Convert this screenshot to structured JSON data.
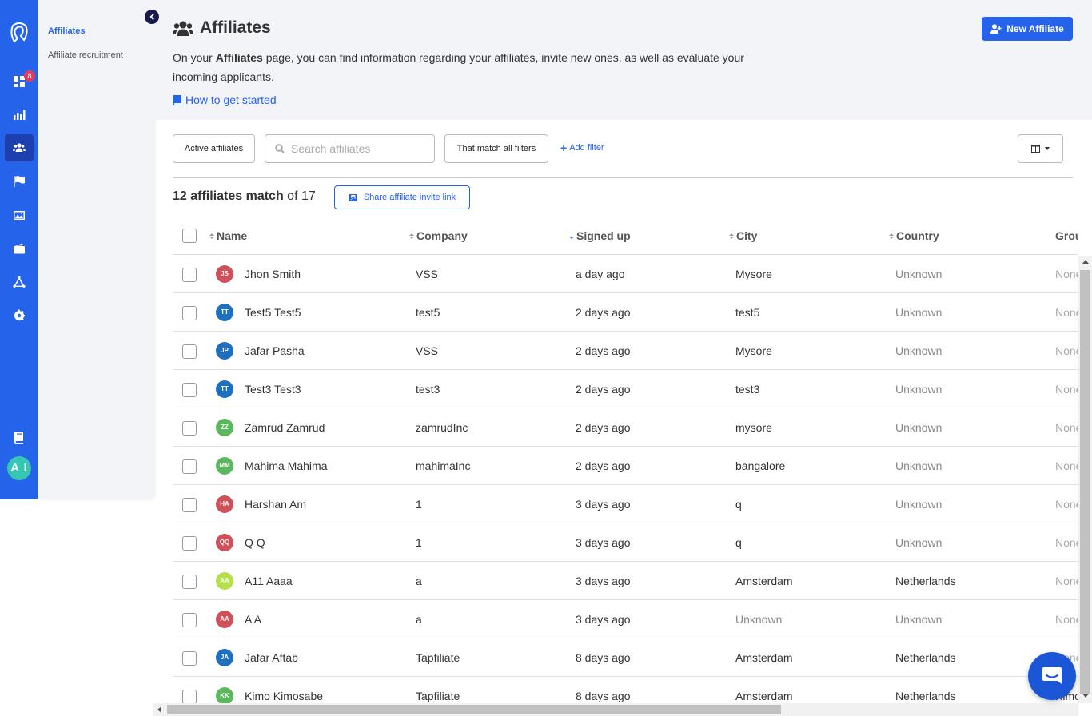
{
  "rail": {
    "badge_count": "8",
    "avatar_initials": "A I",
    "items": [
      {
        "icon": "dashboard-icon"
      },
      {
        "icon": "reports-icon"
      },
      {
        "icon": "affiliates-icon",
        "active": true
      },
      {
        "icon": "programs-flag-icon"
      },
      {
        "icon": "assets-image-icon"
      },
      {
        "icon": "payouts-wallet-icon"
      },
      {
        "icon": "integrations-icon"
      },
      {
        "icon": "settings-gear-icon"
      },
      {
        "icon": "docs-book-icon"
      }
    ]
  },
  "submenu": {
    "items": [
      "Affiliates",
      "Affiliate recruitment"
    ]
  },
  "header": {
    "title": "Affiliates",
    "intro_prefix": "On your ",
    "intro_bold": "Affiliates",
    "intro_suffix": " page, you can find information regarding your affiliates, invite new ones, as well as evaluate your incoming applicants.",
    "help_link": "How to get started",
    "new_button": "New Affiliate"
  },
  "filters": {
    "status": "Active affiliates",
    "search_placeholder": "Search affiliates",
    "match_mode": "That match all filters",
    "add_filter": "Add filter"
  },
  "summary": {
    "match_count": "12 affiliates match",
    "total": " of 17",
    "share_button": "Share affiliate invite link"
  },
  "table": {
    "columns": [
      "Name",
      "Company",
      "Signed up",
      "City",
      "Country",
      "Group"
    ],
    "rows": [
      {
        "initials": "JS",
        "color": "#d0505a",
        "name": "Jhon Smith",
        "company": "VSS",
        "signed_up": "a day ago",
        "city": "Mysore",
        "country": "Unknown",
        "group": "None"
      },
      {
        "initials": "TT",
        "color": "#1e6fc0",
        "name": "Test5 Test5",
        "company": "test5",
        "signed_up": "2 days ago",
        "city": "test5",
        "country": "Unknown",
        "group": "None"
      },
      {
        "initials": "JP",
        "color": "#1e6fc0",
        "name": "Jafar Pasha",
        "company": "VSS",
        "signed_up": "2 days ago",
        "city": "Mysore",
        "country": "Unknown",
        "group": "None"
      },
      {
        "initials": "TT",
        "color": "#1e6fc0",
        "name": "Test3 Test3",
        "company": "test3",
        "signed_up": "2 days ago",
        "city": "test3",
        "country": "Unknown",
        "group": "None"
      },
      {
        "initials": "ZZ",
        "color": "#5cb85c",
        "name": "Zamrud Zamrud",
        "company": "zamrudInc",
        "signed_up": "2 days ago",
        "city": "mysore",
        "country": "Unknown",
        "group": "None"
      },
      {
        "initials": "MM",
        "color": "#5cb85c",
        "name": "Mahima Mahima",
        "company": "mahimaInc",
        "signed_up": "2 days ago",
        "city": "bangalore",
        "country": "Unknown",
        "group": "None"
      },
      {
        "initials": "HA",
        "color": "#d0505a",
        "name": "Harshan Am",
        "company": "1",
        "signed_up": "3 days ago",
        "city": "q",
        "country": "Unknown",
        "group": "None"
      },
      {
        "initials": "QQ",
        "color": "#d0505a",
        "name": "Q Q",
        "company": "1",
        "signed_up": "3 days ago",
        "city": "q",
        "country": "Unknown",
        "group": "None"
      },
      {
        "initials": "AA",
        "color": "#b5e04c",
        "name": "A11 Aaaa",
        "company": "a",
        "signed_up": "3 days ago",
        "city": "Amsterdam",
        "country": "Netherlands",
        "group": "None"
      },
      {
        "initials": "AA",
        "color": "#d0505a",
        "name": "A A",
        "company": "a",
        "signed_up": "3 days ago",
        "city": "Unknown",
        "country": "Unknown",
        "group": "None"
      },
      {
        "initials": "JA",
        "color": "#1e6fc0",
        "name": "Jafar Aftab",
        "company": "Tapfiliate",
        "signed_up": "8 days ago",
        "city": "Amsterdam",
        "country": "Netherlands",
        "group": "None"
      },
      {
        "initials": "KK",
        "color": "#5cb85c",
        "name": "Kimo Kimosabe",
        "company": "Tapfiliate",
        "signed_up": "8 days ago",
        "city": "Amsterdam",
        "country": "Netherlands",
        "group": "Kimo"
      }
    ]
  }
}
